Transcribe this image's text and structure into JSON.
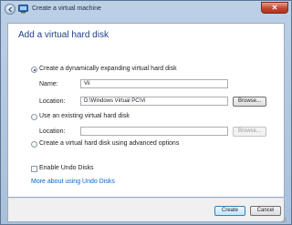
{
  "window": {
    "title": "Create a virtual machine",
    "close_glyph": "✕"
  },
  "page": {
    "heading": "Add a virtual hard disk"
  },
  "options": {
    "dynamic": {
      "label": "Create a dynamically expanding virtual hard disk",
      "checked": true
    },
    "name_label": "Name:",
    "name_value": "Vii",
    "location_label": "Location:",
    "location_value": "D:\\Windows Virtual PC\\Vi",
    "browse_label": "Browse...",
    "existing": {
      "label": "Use an existing virtual hard disk",
      "checked": false
    },
    "existing_location_label": "Location:",
    "existing_location_value": "",
    "existing_browse_label": "Browse...",
    "advanced": {
      "label": "Create a virtual hard disk using advanced options",
      "checked": false
    },
    "undo_disks": {
      "label": "Enable Undo Disks",
      "checked": false
    },
    "more_link": "More about using Undo Disks"
  },
  "footer": {
    "create_label": "Create",
    "cancel_label": "Cancel"
  },
  "icons": {
    "back": "back-arrow-icon",
    "forward": "forward-arrow-icon",
    "app": "virtual-pc-icon",
    "close": "close-icon"
  }
}
